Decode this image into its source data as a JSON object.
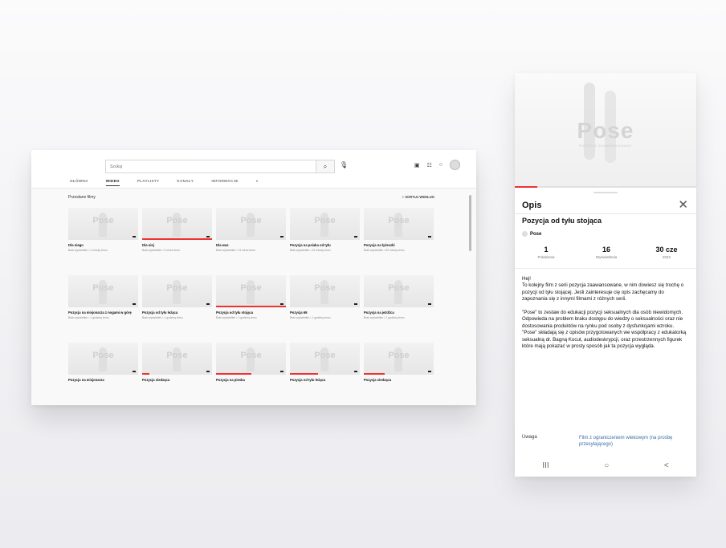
{
  "desktop": {
    "search": {
      "placeholder": "Szukaj"
    },
    "tabs": [
      {
        "label": "GŁÓWNA"
      },
      {
        "label": "WIDEO"
      },
      {
        "label": "PLAYLISTY"
      },
      {
        "label": "KANAŁY"
      },
      {
        "label": "INFORMACJE"
      }
    ],
    "section_title": "Przesłane filmy",
    "sort_label": "SORTUJ WEDŁUG",
    "videos": [
      {
        "title": "Dla niego",
        "meta": "Brak wyświetleń • 2 minuty temu",
        "progress": 0
      },
      {
        "title": "Dla niej",
        "meta": "Brak wyświetleń • 5 minut temu",
        "progress": 1
      },
      {
        "title": "Dla was",
        "meta": "Brak wyświetleń • 13 minut temu",
        "progress": 0
      },
      {
        "title": "Pozycja na psiaka od tyłu",
        "meta": "Brak wyświetleń • 43 minuty temu",
        "progress": 0
      },
      {
        "title": "Pozycja na łyżeczki",
        "meta": "Brak wyświetleń • 52 minuty temu",
        "progress": 0
      },
      {
        "title": "Pozycja na misjonarza z nogami w górę",
        "meta": "Brak wyświetleń • 1 godzinę temu",
        "progress": 0
      },
      {
        "title": "Pozycja od tyłu leżąca",
        "meta": "Brak wyświetleń • 1 godzinę temu",
        "progress": 0
      },
      {
        "title": "Pozycja od tyłu stojąca",
        "meta": "Brak wyświetleń • 1 godzinę temu",
        "progress": 1
      },
      {
        "title": "Pozycja 69",
        "meta": "Brak wyświetleń • 1 godzinę temu",
        "progress": 0
      },
      {
        "title": "Pozycja na jeźdźca",
        "meta": "Brak wyświetleń • 1 godzinę temu",
        "progress": 0
      },
      {
        "title": "Pozycja na misjonarza",
        "meta": "",
        "progress": 0
      },
      {
        "title": "Pozycja siedząca",
        "meta": "",
        "progress": 0.1
      },
      {
        "title": "Pozycja na pieska",
        "meta": "",
        "progress": 0.5
      },
      {
        "title": "Pozycja od tyłu leżąca",
        "meta": "",
        "progress": 0.4
      },
      {
        "title": "Pozycja siedząca",
        "meta": "",
        "progress": 0.3
      }
    ]
  },
  "phone": {
    "video_logo": "Pose",
    "video_sub": "POZYCJE ZAAWANSOWANE",
    "panel_title": "Opis",
    "video_title": "Pozycja od tyłu stojąca",
    "channel": "Pose",
    "stats": [
      {
        "num": "1",
        "label": "Polubienia"
      },
      {
        "num": "16",
        "label": "Wyświetlenia"
      },
      {
        "num": "30 cze",
        "label": "2022"
      }
    ],
    "description": "Hej!\nTo kolejny film z serii pozycja zaawansowane, w nim dowiesz się trochę o pozycji od tyłu stojącej. Jeśli zainteresuje cię opis zachęcamy do zapoznania się z innymi filmami z różnych serii.\n\n\"Pose\" to zestaw do edukacji pozycji seksualnych dla osób niewidomych. Odpowieda na problem braku dostępu do wiedzy o seksualności oraz nie dostosowania produktów na rynku pod osoby z dysfunkcjami wzroku. \"Pose\" składają się z opisów przygotowanych we współpracy z edukatorką seksualną dr. Bagną Kocut, audiodeskrypcji, oraz przestrzennych figurek które mają pokazać w prosty sposób jak ta pozycja wygląda.",
    "uwaga_label": "Uwaga",
    "uwaga_value": "Film z ograniczeniem wiekowym (na prośbę przesyłającego)",
    "nav": {
      "recent": "III",
      "home": "○",
      "back": "<"
    }
  },
  "colors": {
    "accent": "#e33333",
    "link": "#3b6ea8"
  }
}
